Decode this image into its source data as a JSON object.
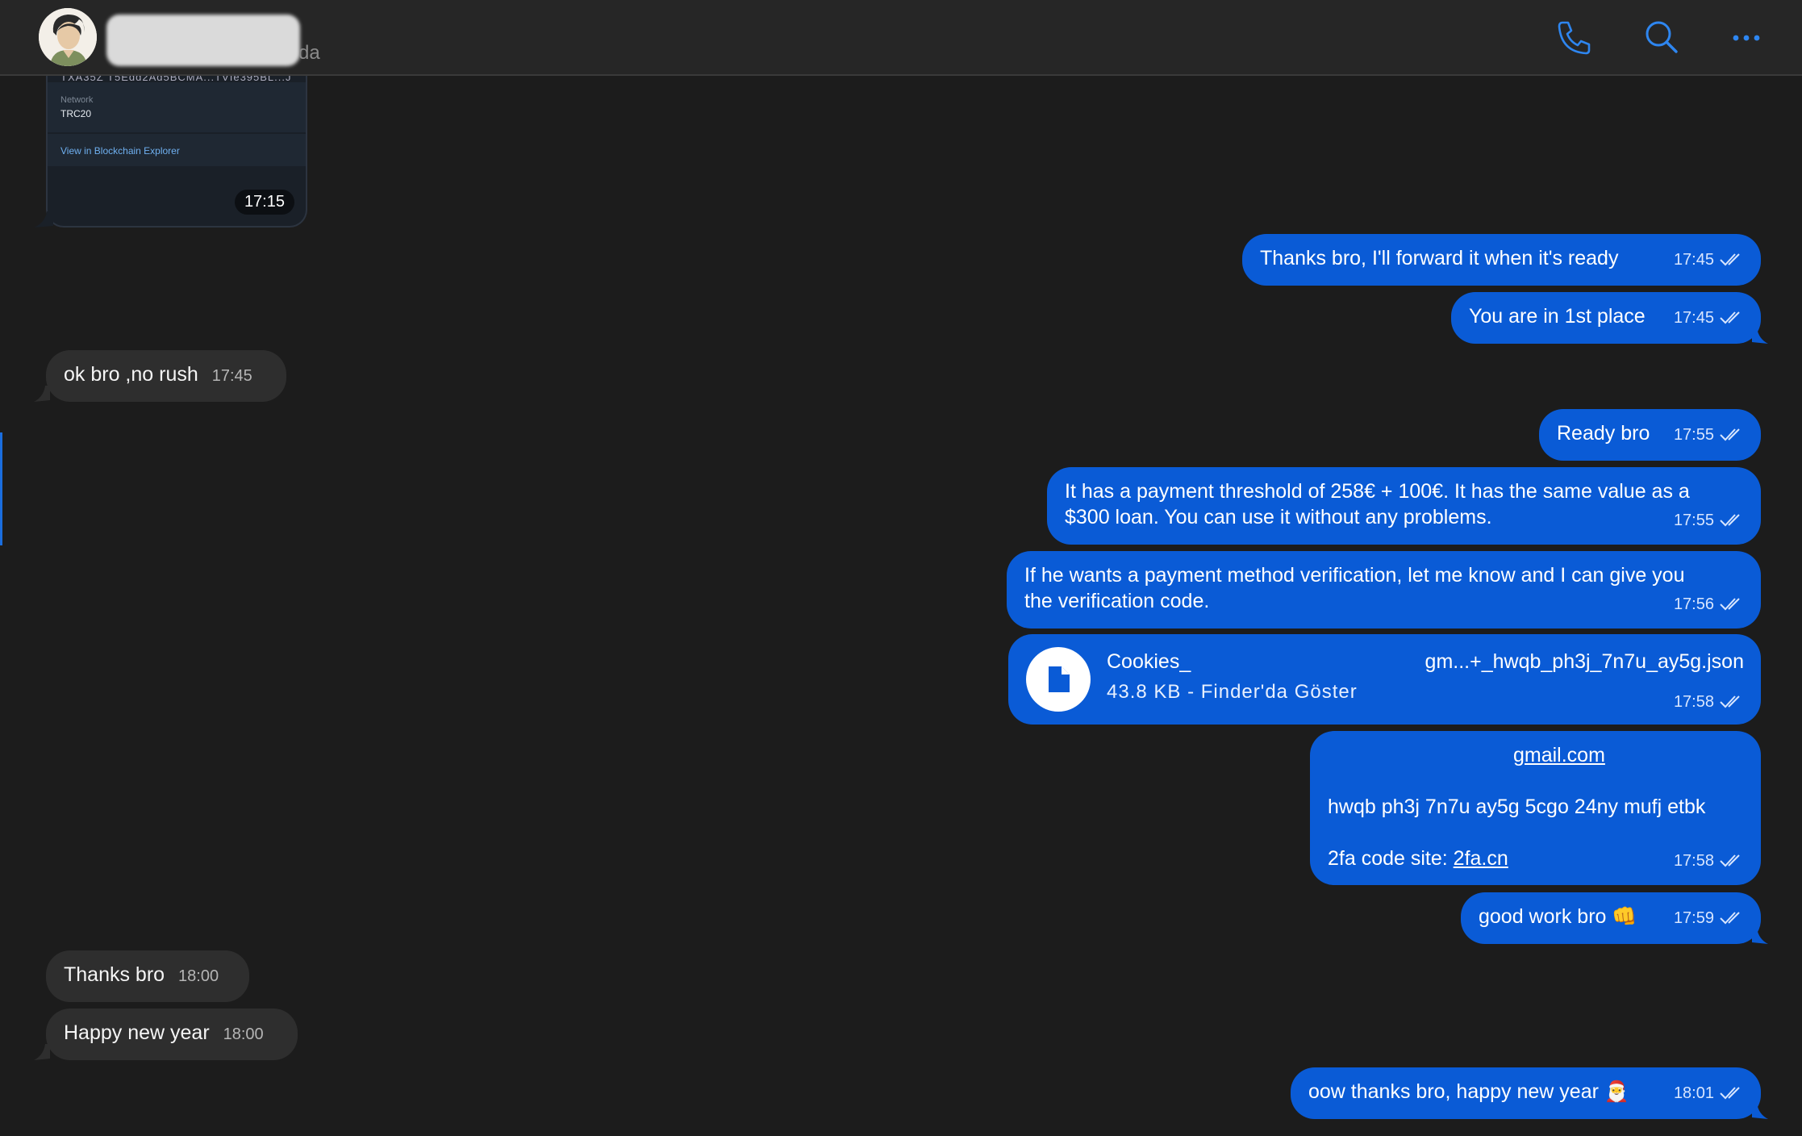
{
  "header": {
    "status_suffix": "da",
    "icons": [
      "phone-icon",
      "search-icon",
      "more-icon"
    ]
  },
  "card": {
    "hash_fragment": "TXA35Z T5Edd2Ad5BCMA...TVIe395BL...J",
    "network_label": "Network",
    "network_value": "TRC20",
    "explorer_link": "View in Blockchain Explorer",
    "time": "17:15"
  },
  "messages": {
    "m1": {
      "text": "Thanks bro, I'll forward it when it's ready",
      "time": "17:45"
    },
    "m2": {
      "text": "You are in 1st place",
      "time": "17:45"
    },
    "m3": {
      "text": "ok bro ,no rush",
      "time": "17:45"
    },
    "m4": {
      "text": "Ready bro",
      "time": "17:55"
    },
    "m5": {
      "line1": "It has a payment threshold of 258€ + 100€. It has the same value as a",
      "line2": "$300 loan. You can use it without any problems.",
      "time": "17:55"
    },
    "m6": {
      "line1": "If he wants a payment method verification, let me know and I can give you",
      "line2": "the verification code.",
      "time": "17:56"
    },
    "m7": {
      "name_start": "Cookies_",
      "name_end": "gm...+_hwqb_ph3j_7n7u_ay5g.json",
      "size": "43.8 KB - Finder'da Göster",
      "time": "17:58"
    },
    "m8": {
      "email": "gmail.com",
      "code": "hwqb ph3j 7n7u ay5g 5cgo 24ny mufj etbk",
      "site_label": "2fa code site:",
      "site_link": "2fa.cn",
      "time": "17:58"
    },
    "m9": {
      "text": "good work bro",
      "emoji": "👊",
      "time": "17:59"
    },
    "m10": {
      "text": "Thanks bro",
      "time": "18:00"
    },
    "m11": {
      "text": "Happy new year",
      "time": "18:00"
    },
    "m12": {
      "text": "oow thanks bro, happy new year",
      "emoji": "🎅",
      "time": "18:01"
    }
  },
  "colors": {
    "outgoing": "#0a5bd6",
    "incoming": "#2e2e2e",
    "background": "#1c1c1c",
    "accent": "#1a6dde"
  }
}
